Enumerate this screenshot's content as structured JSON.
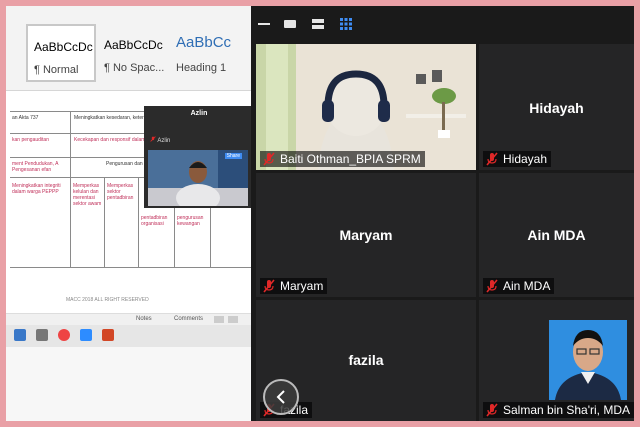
{
  "word": {
    "styles": [
      {
        "preview": "AaBbCcDc",
        "name": "¶ Normal"
      },
      {
        "preview": "AaBbCcDc",
        "name": "¶ No Spac..."
      },
      {
        "preview": "AaBbCc",
        "name": "Heading 1"
      }
    ],
    "doc_snippets": {
      "cell1": "an Akta 737",
      "cell2": "Meningkatkan kesedaran, keter",
      "cell3": "kan pengauditan",
      "cell4": "Kecekapan dan responsif dalam",
      "cell5": "ment Pendudukan, A Pengesanan efan",
      "cell6": "Pengurusan dan",
      "row_a": "Meningkatkan integriti dalam warga PEPPP",
      "row_b": "Memperkas kelulan dan merentasi sektor awam",
      "row_c": "Memperkas sektor pentadbiran",
      "row_d": "pentadbiran organisasi",
      "row_e": "pengurusan kewangan",
      "footer": "MACC 2018 ALL RIGHT RESERVED"
    },
    "status": {
      "notes": "Notes",
      "comments": "Comments"
    }
  },
  "selfview": {
    "title": "Azlin",
    "participant": "Azlin",
    "tag": "Share"
  },
  "zoom": {
    "tiles": [
      {
        "name": "Baiti Othman_BPIA SPRM",
        "center": "",
        "video": true
      },
      {
        "name": "Hidayah",
        "center": "Hidayah",
        "video": false
      },
      {
        "name": "Maryam",
        "center": "Maryam",
        "video": false
      },
      {
        "name": "Ain MDA",
        "center": "Ain MDA",
        "video": false
      },
      {
        "name": "fazila",
        "center": "fazila",
        "video": false
      },
      {
        "name": "Salman bin Sha'ri, MDA",
        "center": "",
        "video": true
      }
    ],
    "toolbar_icons": [
      "minimize-icon",
      "restore-icon",
      "layout-icon",
      "gallery-grid-icon"
    ],
    "colors": {
      "mic_muted": "#e02828",
      "accent_grid": "#3f8cf2",
      "tile_bg": "#252526"
    }
  }
}
